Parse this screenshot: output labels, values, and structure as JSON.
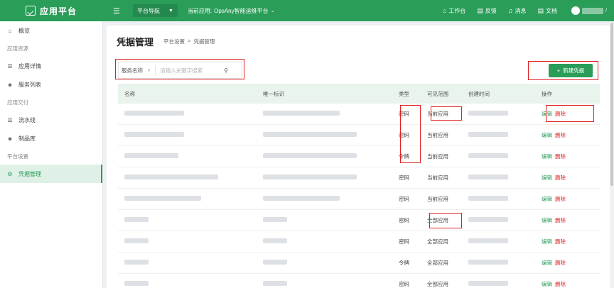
{
  "topbar": {
    "brand": "应用平台",
    "menu_icon": "menu-icon",
    "nav_select": "平台导航",
    "current_app_label": "当前应用:",
    "current_app_value": "OpsAny智能运维平台",
    "links": [
      {
        "icon": "home-icon",
        "glyph": "⌂",
        "label": "工作台"
      },
      {
        "icon": "feedback-icon",
        "glyph": "▤",
        "label": "反馈"
      },
      {
        "icon": "bell-icon",
        "glyph": "♫",
        "label": "消息"
      },
      {
        "icon": "doc-icon",
        "glyph": "▤",
        "label": "文档"
      }
    ]
  },
  "sidebar": {
    "items": [
      {
        "type": "item",
        "icon": "home-icon",
        "glyph": "⌂",
        "label": "概览"
      },
      {
        "type": "group",
        "label": "应用资源"
      },
      {
        "type": "item",
        "icon": "list-icon",
        "glyph": "☰",
        "label": "应用详情"
      },
      {
        "type": "item",
        "icon": "service-icon",
        "glyph": "◈",
        "label": "服务列表"
      },
      {
        "type": "group",
        "label": "应用交付"
      },
      {
        "type": "item",
        "icon": "pipeline-icon",
        "glyph": "☰",
        "label": "流水线"
      },
      {
        "type": "item",
        "icon": "artifact-icon",
        "glyph": "◈",
        "label": "制品库"
      },
      {
        "type": "group",
        "label": "平台设置"
      },
      {
        "type": "item",
        "icon": "gear-icon",
        "glyph": "⚙",
        "label": "凭据管理",
        "active": true
      }
    ]
  },
  "main": {
    "title": "凭据管理",
    "breadcrumb": [
      "平台设置",
      ">",
      "凭据管理"
    ],
    "filter_label": "服务名称",
    "search_placeholder": "请输入关键字搜索",
    "new_button": "新建凭据",
    "columns": [
      "名称",
      "唯一标识",
      "类型",
      "可见范围",
      "创建时间",
      "操作"
    ],
    "rows": [
      {
        "type": "密码",
        "scope": "当前应用",
        "edit": "编辑",
        "del": "删除"
      },
      {
        "type": "密码",
        "scope": "当前应用",
        "edit": "编辑",
        "del": "删除"
      },
      {
        "type": "令牌",
        "scope": "当前应用",
        "edit": "编辑",
        "del": "删除"
      },
      {
        "type": "密码",
        "scope": "当前应用",
        "edit": "编辑",
        "del": "删除"
      },
      {
        "type": "密码",
        "scope": "当前应用",
        "edit": "编辑",
        "del": "删除"
      },
      {
        "type": "密码",
        "scope": "全部应用",
        "edit": "编辑",
        "del": "删除"
      },
      {
        "type": "密码",
        "scope": "全部应用",
        "edit": "编辑",
        "del": "删除"
      },
      {
        "type": "令牌",
        "scope": "全部应用",
        "edit": "编辑",
        "del": "删除"
      },
      {
        "type": "密码",
        "scope": "全部应用",
        "edit": "编辑",
        "del": "删除"
      }
    ]
  },
  "colors": {
    "accent": "#2a9d59",
    "danger": "#e02020",
    "header_bg": "#e8f4ec"
  }
}
